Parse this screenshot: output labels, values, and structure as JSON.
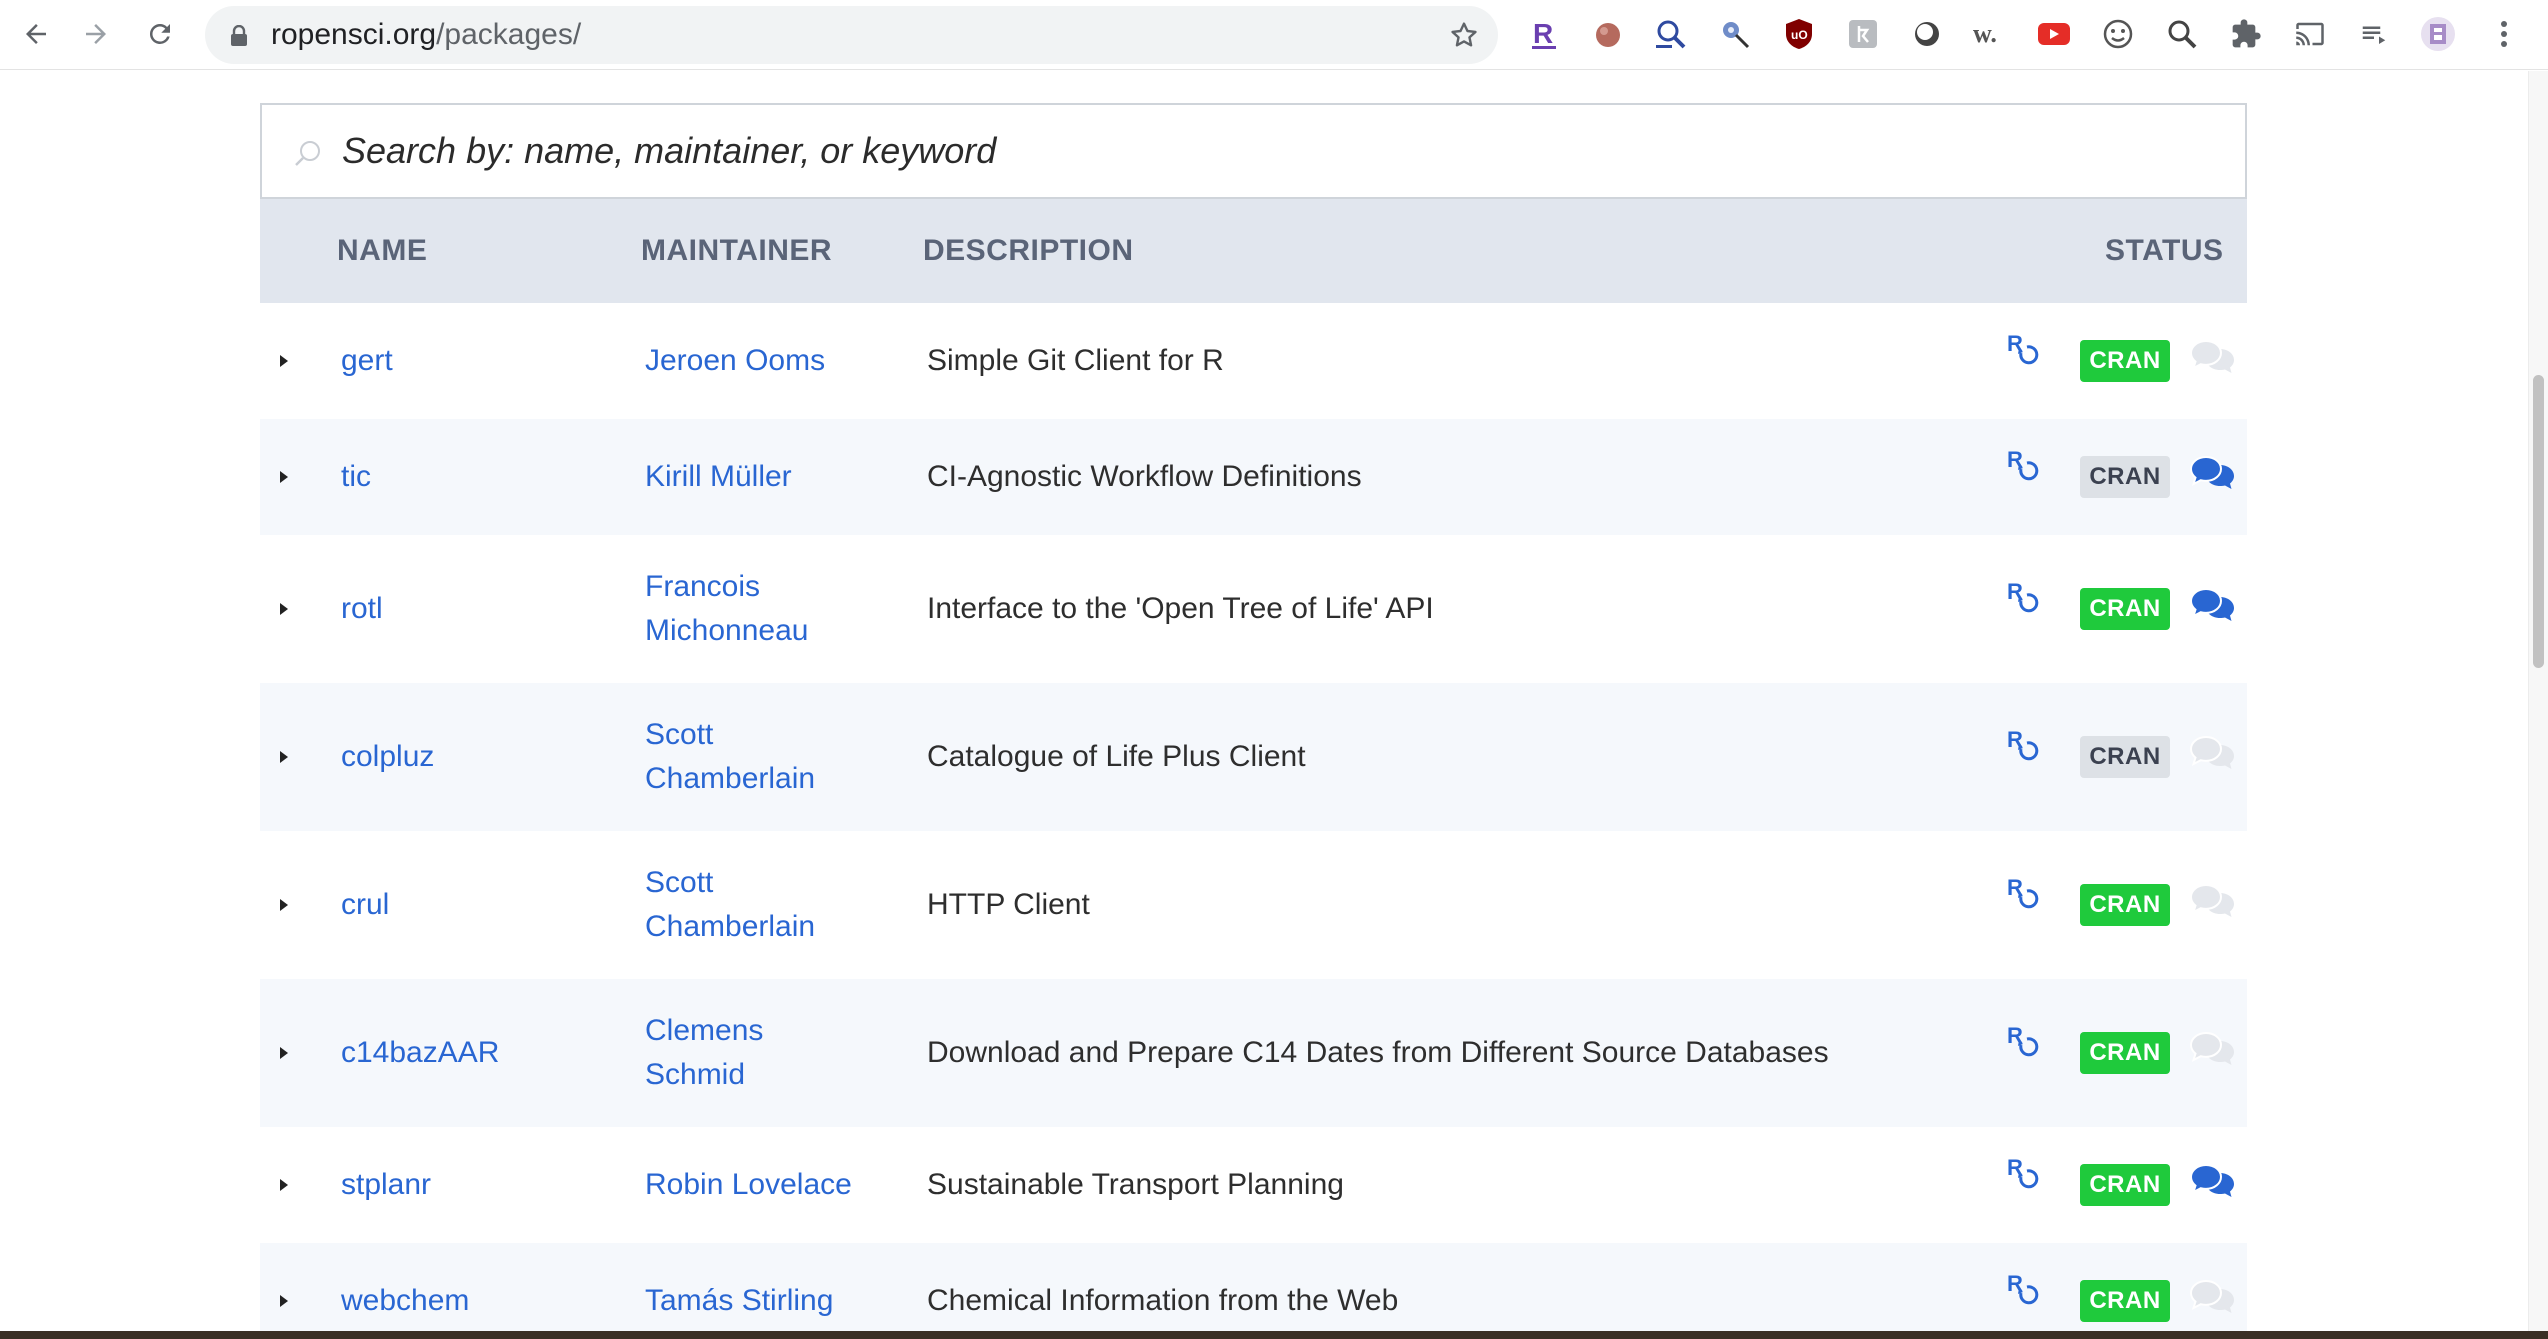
{
  "browser": {
    "url_host": "ropensci.org",
    "url_path": "/packages/"
  },
  "search": {
    "placeholder": "Search by: name, maintainer, or keyword"
  },
  "table": {
    "headers": {
      "name": "NAME",
      "maintainer": "MAINTAINER",
      "description": "DESCRIPTION",
      "status": "STATUS"
    },
    "rows": [
      {
        "name": "gert",
        "maintainer": "Jeroen Ooms",
        "description": "Simple Git Client for R",
        "status": "CRAN",
        "cran_active": true,
        "discussion_active": false
      },
      {
        "name": "tic",
        "maintainer": "Kirill Müller",
        "description": "CI-Agnostic Workflow Definitions",
        "status": "CRAN",
        "cran_active": false,
        "discussion_active": true
      },
      {
        "name": "rotl",
        "maintainer": "Francois Michonneau",
        "description": "Interface to the 'Open Tree of Life' API",
        "status": "CRAN",
        "cran_active": true,
        "discussion_active": true
      },
      {
        "name": "colpluz",
        "maintainer": "Scott Chamberlain",
        "description": "Catalogue of Life Plus Client",
        "status": "CRAN",
        "cran_active": false,
        "discussion_active": false
      },
      {
        "name": "crul",
        "maintainer": "Scott Chamberlain",
        "description": "HTTP Client",
        "status": "CRAN",
        "cran_active": true,
        "discussion_active": false
      },
      {
        "name": "c14bazAAR",
        "maintainer": "Clemens Schmid",
        "description": "Download and Prepare C14 Dates from Different Source Databases",
        "status": "CRAN",
        "cran_active": true,
        "discussion_active": false
      },
      {
        "name": "stplanr",
        "maintainer": "Robin Lovelace",
        "description": "Sustainable Transport Planning",
        "status": "CRAN",
        "cran_active": true,
        "discussion_active": true
      },
      {
        "name": "webchem",
        "maintainer": "Tamás Stirling",
        "description": "Chemical Information from the Web",
        "status": "CRAN",
        "cran_active": true,
        "discussion_active": false
      }
    ]
  },
  "colors": {
    "link": "#2966d2",
    "cran_green": "#1fca3c",
    "cran_grey": "#dde1e6",
    "header_bg": "#e1e6ee",
    "chat_active": "#2966d2",
    "chat_inactive": "#e4e7ec"
  },
  "icons": {
    "back": "arrow-left-icon",
    "forward": "arrow-right-icon",
    "reload": "reload-icon",
    "lock": "lock-icon",
    "bookmark": "star-icon",
    "expand": "caret-right-icon",
    "repo_status": "ro-docs-icon",
    "discussion": "chat-bubbles-icon",
    "search": "search-icon",
    "extensions": [
      "r-extension-icon",
      "tomato-extension-icon",
      "zoom-magnifier-icon",
      "satellite-extension-icon",
      "ublock-icon",
      "hieroglyph-extension-icon",
      "circle-extension-icon",
      "w-extension-icon",
      "youtube-extension-icon",
      "smiley-extension-icon",
      "search-extension-icon",
      "puzzle-extensions-icon",
      "cast-icon",
      "reading-list-icon",
      "profile-avatar-icon",
      "menu-kebab-icon"
    ]
  }
}
